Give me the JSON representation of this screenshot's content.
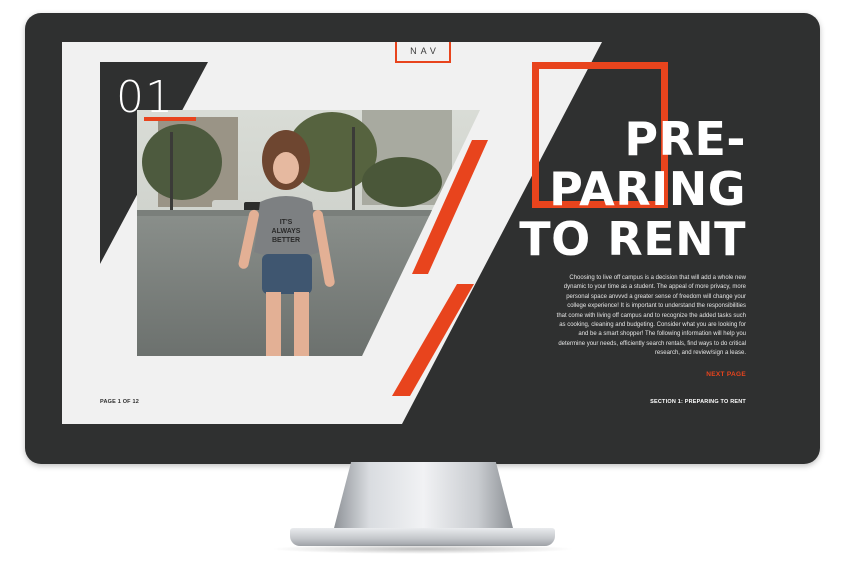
{
  "nav": {
    "label": "NAV"
  },
  "section_number": "01",
  "title": {
    "lines": [
      "PRE-",
      "PARING",
      "TO RENT"
    ]
  },
  "body": "Choosing to live off campus is a decision that will add a whole new dynamic to your time as a student. The appeal of more privacy, more personal space anvvvd a greater sense of freedom will change your college experience! It is important to understand the responsibilities that come with living off campus and to recognize the added tasks such as cooking, cleaning and budgeting. Consider what you are looking for and be a smart shopper! The following information will help you determine your needs, efficiently search rentals, find ways to do critical research, and review/sign a lease.",
  "next_page": "NEXT PAGE",
  "page_indicator": "PAGE 1 OF 12",
  "section_label": "SECTION 1: PREPARING TO RENT",
  "colors": {
    "accent": "#e8441d",
    "dark": "#2f3030",
    "light": "#f1f1f1"
  }
}
